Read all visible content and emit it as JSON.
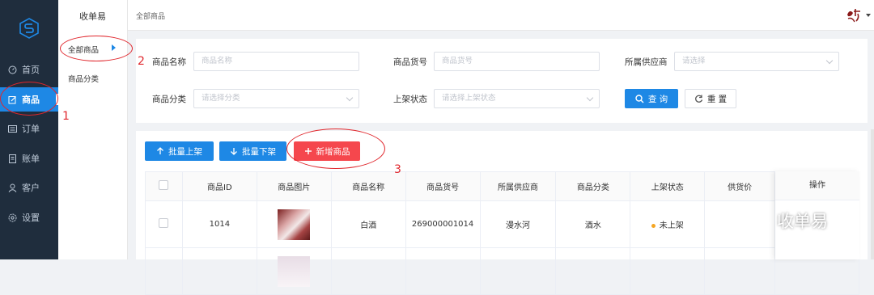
{
  "sidebar": {
    "logo_icon": "s-logo-icon",
    "items": [
      {
        "label": "首页",
        "icon": "dashboard-icon"
      },
      {
        "label": "商品",
        "icon": "edit-icon"
      },
      {
        "label": "订单",
        "icon": "list-icon"
      },
      {
        "label": "账单",
        "icon": "bill-icon"
      },
      {
        "label": "客户",
        "icon": "user-icon"
      },
      {
        "label": "设置",
        "icon": "gear-icon"
      }
    ]
  },
  "subnav": {
    "title": "收单易",
    "items": [
      {
        "label": "全部商品"
      },
      {
        "label": "商品分类"
      }
    ]
  },
  "header": {
    "breadcrumb": "全部商品"
  },
  "filters": {
    "name_label": "商品名称",
    "name_placeholder": "商品名称",
    "code_label": "商品货号",
    "code_placeholder": "商品货号",
    "supplier_label": "所属供应商",
    "supplier_placeholder": "请选择",
    "category_label": "商品分类",
    "category_placeholder": "请选择分类",
    "status_label": "上架状态",
    "status_placeholder": "请选择上架状态",
    "search_label": "查 询",
    "reset_label": "重 置"
  },
  "actions": {
    "batch_on": "批量上架",
    "batch_off": "批量下架",
    "add": "新增商品"
  },
  "table": {
    "headers": [
      "商品ID",
      "商品图片",
      "商品名称",
      "商品货号",
      "所属供应商",
      "商品分类",
      "上架状态",
      "供货价",
      "操作"
    ],
    "rows": [
      {
        "id": "1014",
        "name": "白酒",
        "code": "269000001014",
        "supplier": "漫水河",
        "category": "酒水",
        "status": "未上架",
        "price": ""
      }
    ]
  },
  "annotations": {
    "n1": "1",
    "n2": "2",
    "n3": "3"
  },
  "watermark": {
    "text": "收单易",
    "icon": "wechat-icon"
  },
  "colors": {
    "accent": "#1e88e5",
    "danger": "#f5474d",
    "sidebar": "#1f2d3d",
    "annotation": "#e0262c"
  }
}
